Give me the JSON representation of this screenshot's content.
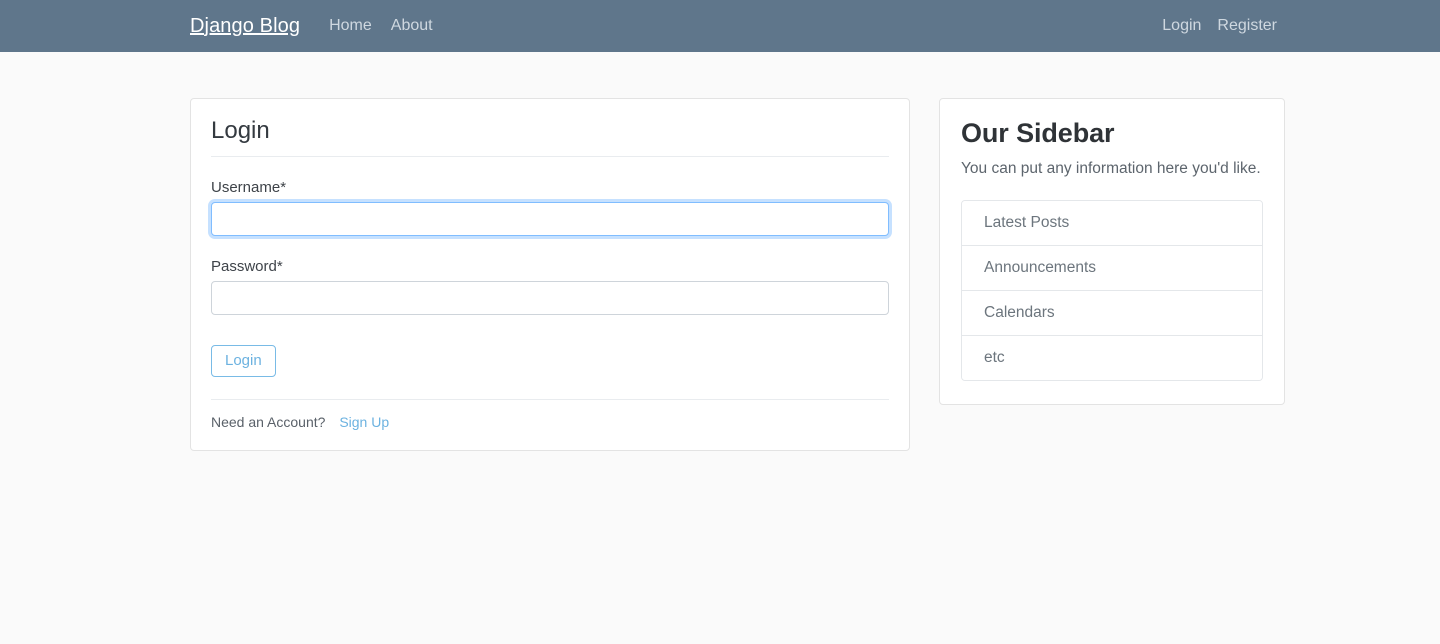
{
  "navbar": {
    "brand": "Django Blog",
    "left_links": [
      {
        "label": "Home"
      },
      {
        "label": "About"
      }
    ],
    "right_links": [
      {
        "label": "Login"
      },
      {
        "label": "Register"
      }
    ],
    "background_color": "#5f768b",
    "brand_color": "#ffffff",
    "link_color": "#cfd8e0"
  },
  "login_form": {
    "legend": "Login",
    "username": {
      "label": "Username*",
      "value": "",
      "placeholder": "",
      "focused": true
    },
    "password": {
      "label": "Password*",
      "value": "",
      "placeholder": "",
      "focused": false
    },
    "submit_label": "Login",
    "footer_text": "Need an Account?",
    "footer_link_label": "Sign Up",
    "accent_color": "#6cb2e0",
    "focus_ring_color": "#80bdff"
  },
  "sidebar": {
    "title": "Our Sidebar",
    "description": "You can put any information here you'd like.",
    "items": [
      {
        "label": "Latest Posts"
      },
      {
        "label": "Announcements"
      },
      {
        "label": "Calendars"
      },
      {
        "label": "etc"
      }
    ]
  },
  "page": {
    "background_color": "#fafafa"
  }
}
